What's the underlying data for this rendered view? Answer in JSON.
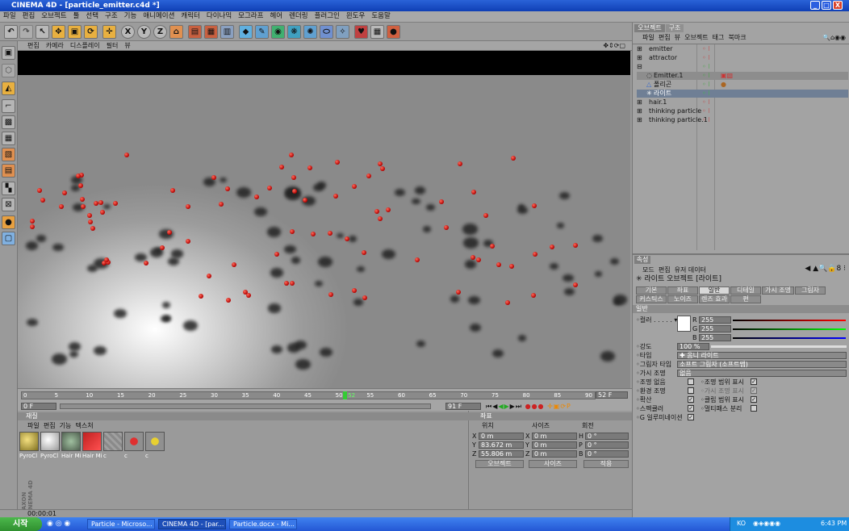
{
  "window": {
    "title": "CINEMA 4D - [particle_emitter.c4d *]",
    "min": "_",
    "max": "□",
    "close": "X"
  },
  "menu": [
    "파일",
    "편집",
    "오브젝트",
    "툴",
    "선택",
    "구조",
    "기능",
    "애니메이션",
    "캐릭터",
    "다이나믹",
    "모그라프",
    "헤어",
    "렌더링",
    "플러그인",
    "윈도우",
    "도움말"
  ],
  "toolbar": {
    "icons": [
      "undo-icon",
      "redo-icon",
      "select-icon",
      "move-icon",
      "scale-icon",
      "rotate-icon",
      "axis-icon",
      "x-lock",
      "y-lock",
      "z-lock",
      "coord-icon",
      "render-view-icon",
      "render-pic-icon",
      "render-settings-icon",
      "cube-icon",
      "spline-pen-icon",
      "nurbs-icon",
      "array-icon",
      "deformer-icon",
      "scene-icon",
      "environment-icon",
      "camera-icon",
      "light-icon",
      "tag-icon"
    ],
    "xyz": [
      "X",
      "Y",
      "Z"
    ]
  },
  "viewport": {
    "menu": [
      "편집",
      "카메라",
      "디스플레이",
      "필터",
      "뷰"
    ]
  },
  "timeline": {
    "ticks": [
      "0",
      "5",
      "10",
      "15",
      "20",
      "25",
      "30",
      "35",
      "40",
      "45",
      "50",
      "52",
      "55",
      "60",
      "65",
      "70",
      "75",
      "80",
      "85",
      "90"
    ],
    "current_frame": "52 F",
    "start": "0 F",
    "end": "91 F",
    "end_short": "91",
    "current_frame_index": 52,
    "max_frame": 90
  },
  "material": {
    "title": "재질",
    "menu": [
      "파일",
      "편집",
      "기능",
      "텍스처"
    ],
    "items": [
      "PyroCl",
      "PyroCl",
      "Hair Mi",
      "Hair Mi",
      "c",
      "c",
      "c"
    ]
  },
  "coords": {
    "title": "좌표",
    "headers": [
      "위치",
      "사이즈",
      "회전"
    ],
    "pos": [
      "0 m",
      "83.672 m",
      "55.806 m"
    ],
    "size": [
      "0 m",
      "0 m",
      "0 m"
    ],
    "rot": [
      "0 °",
      "0 °",
      "0 °"
    ],
    "axes_pos": [
      "X",
      "Y",
      "Z"
    ],
    "axes_size": [
      "X",
      "Y",
      "Z"
    ],
    "axes_rot": [
      "H",
      "P",
      "B"
    ],
    "mode": "오브젝트",
    "size_mode": "사이즈",
    "apply": "적용"
  },
  "objmgr": {
    "tabs": [
      "오브젝트",
      "구조"
    ],
    "menu": [
      "파일",
      "편집",
      "뷰",
      "오브젝트",
      "태그",
      "북마크"
    ],
    "objects": [
      "emitter",
      "attractor",
      "",
      "Emitter.1",
      "폴리곤",
      "라이트",
      "hair.1",
      "thinking particle",
      "thinking particle.1"
    ]
  },
  "attr": {
    "tab": "속성",
    "menu": [
      "모드",
      "편집",
      "유저 데이터"
    ],
    "title": "라이트 오브젝트 [라이트]",
    "tabs_row1": [
      "기본",
      "좌표",
      "일반",
      "디테일",
      "가시 조명",
      "그림자"
    ],
    "tabs_row2": [
      "커스틱스",
      "노이즈",
      "렌즈 효과",
      "편"
    ],
    "section": "일반",
    "color_label": "컬러",
    "r": "255",
    "g": "255",
    "b": "255",
    "r_label": "R",
    "g_label": "G",
    "b_label": "B",
    "intensity_label": "강도",
    "intensity": "100 %",
    "intensity_value": 1.0,
    "type_label": "타입",
    "type": "옴니 라이트",
    "shadow_label": "그림자 타입",
    "shadow": "소프트 그림자 (소프트맵)",
    "vis_label": "가시 조명",
    "vis": "없음",
    "opts": [
      "조명 없음",
      "조명 범위 표시",
      "환경 조명",
      "가시 조명 표시",
      "확산",
      "클립 범위 표시",
      "스펙큘러",
      "멀티패스 분리",
      "G 일루미네이션"
    ]
  },
  "status": {
    "time": "00:00:01"
  },
  "taskbar": {
    "start": "시작",
    "tasks": [
      "Particle - Microso...",
      "CINEMA 4D - [par...",
      "Particle.docx - Mi..."
    ],
    "lang": "KO",
    "clock": "6:43 PM"
  },
  "brand": "MAXON CINEMA 4D"
}
